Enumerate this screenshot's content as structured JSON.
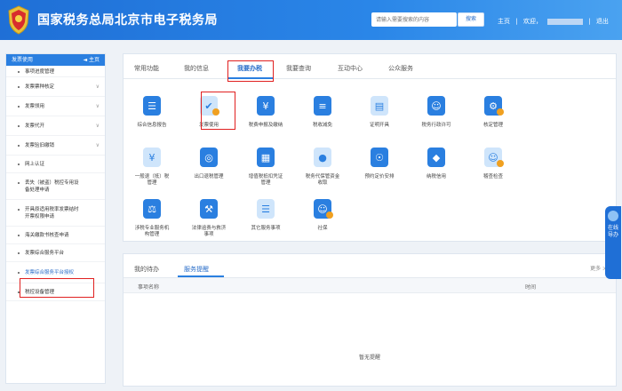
{
  "header": {
    "title": "国家税务总局北京市电子税务局",
    "search_placeholder": "请输入需要搜索的内容",
    "search_label": "搜索",
    "home_label": "主页",
    "welcome_label": "欢迎，",
    "exit_label": "退出",
    "accent": "#2a7fe0"
  },
  "sidebar": {
    "title": "发票使用",
    "home": "◄ 主页",
    "items": [
      {
        "label": "事项进度管理",
        "chev": ""
      },
      {
        "label": "发票票种核定",
        "chev": "∨"
      },
      {
        "label": "发票领用",
        "chev": "∨"
      },
      {
        "label": "发票代开",
        "chev": "∨"
      },
      {
        "label": "发票验旧缴销",
        "chev": "∨"
      },
      {
        "label": "网上认证",
        "chev": ""
      },
      {
        "label": "丢失（被盗）税控专用设",
        "label2": "备处理申请",
        "chev": ""
      },
      {
        "label": "开具原适用税率发票结时",
        "label2": "开票权限申请",
        "chev": ""
      },
      {
        "label": "海关缴款书核查申请",
        "chev": ""
      },
      {
        "label": "发票综合服务平台",
        "chev": ""
      },
      {
        "label": "发票综合服务平台授权",
        "chev": ""
      },
      {
        "label": "税控设备管理",
        "chev": ""
      }
    ]
  },
  "tabs": [
    "常用功能",
    "我的信息",
    "我要办税",
    "我要查询",
    "互动中心",
    "公众服务"
  ],
  "services": [
    {
      "label": "综合信息报告",
      "icon": "report-icon"
    },
    {
      "label": "发票使用",
      "icon": "invoice-icon"
    },
    {
      "label": "税费申报及缴纳",
      "icon": "tax-declare-icon"
    },
    {
      "label": "税收减免",
      "icon": "tax-relief-icon"
    },
    {
      "label": "证明开具",
      "icon": "certificate-icon"
    },
    {
      "label": "税务行政许可",
      "icon": "permit-icon"
    },
    {
      "label": "核定管理",
      "icon": "verify-icon"
    },
    {
      "label": "一般退（抵）税",
      "label2": "管理",
      "icon": "refund-icon"
    },
    {
      "label": "出口退税管理",
      "icon": "export-refund-icon"
    },
    {
      "label": "增值税抵扣凭证",
      "label2": "管理",
      "icon": "vat-voucher-icon"
    },
    {
      "label": "税务代保管资金",
      "label2": "收取",
      "icon": "fund-icon"
    },
    {
      "label": "预约定价安排",
      "icon": "pricing-icon"
    },
    {
      "label": "纳税信用",
      "icon": "credit-icon"
    },
    {
      "label": "稽查检查",
      "icon": "inspection-icon"
    },
    {
      "label": "涉税专业服务机",
      "label2": "构管理",
      "icon": "agency-icon"
    },
    {
      "label": "法律追责与救济",
      "label2": "事项",
      "icon": "law-icon"
    },
    {
      "label": "其它服务事项",
      "icon": "other-icon"
    },
    {
      "label": "社保",
      "icon": "social-security-icon"
    }
  ],
  "notify": {
    "tabs": [
      "我的待办",
      "服务提醒"
    ],
    "more": "更多 >",
    "col_item": "事项名称",
    "col_time": "时间",
    "empty": "暂无提醒"
  },
  "float_help": "在线导办"
}
